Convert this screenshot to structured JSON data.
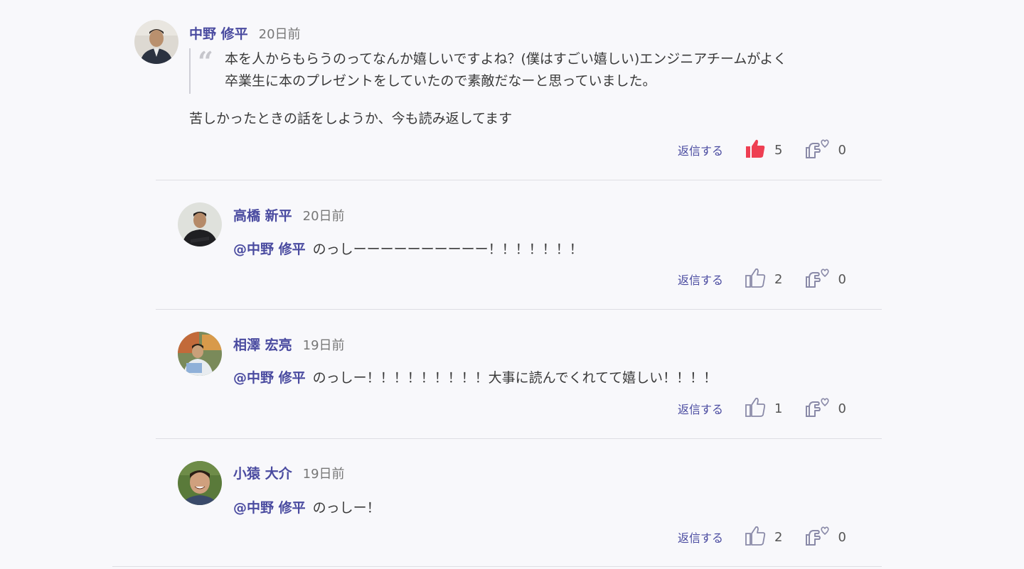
{
  "comments": [
    {
      "author": "中野 修平",
      "time": "20日前",
      "quote_line1": "本を人からもらうのってなんか嬉しいですよね？(僕はすごい嬉しい)エンジニアチームがよく",
      "quote_line2": "卒業生に本のプレゼントをしていたので素敵だなーと思っていました。",
      "text": "苦しかったときの話をしようか、今も読み返してます",
      "reply_label": "返信する",
      "likes": "5",
      "liked": true,
      "hearts": "0"
    },
    {
      "author": "高橋 新平",
      "time": "20日前",
      "mention": "@中野 修平",
      "text": "のっしーーーーーーーーーー！！！！！！！",
      "reply_label": "返信する",
      "likes": "2",
      "hearts": "0"
    },
    {
      "author": "相澤 宏亮",
      "time": "19日前",
      "mention": "@中野 修平",
      "text": "のっしー！！！！！！！！！大事に読んでくれてて嬉しい！！！！",
      "reply_label": "返信する",
      "likes": "1",
      "hearts": "0"
    },
    {
      "author": "小猿 大介",
      "time": "19日前",
      "mention": "@中野 修平",
      "text": "のっしー！",
      "reply_label": "返信する",
      "likes": "2",
      "hearts": "0"
    }
  ],
  "icons": {
    "like": "thumbs-up-icon",
    "heart": "heart-hands-icon",
    "quote": "quote-icon"
  },
  "colors": {
    "accent": "#4a4ba0",
    "liked": "#ee3f52",
    "icon": "#8a8aa8",
    "background": "#f8f8fb",
    "divider": "#dedee3"
  }
}
